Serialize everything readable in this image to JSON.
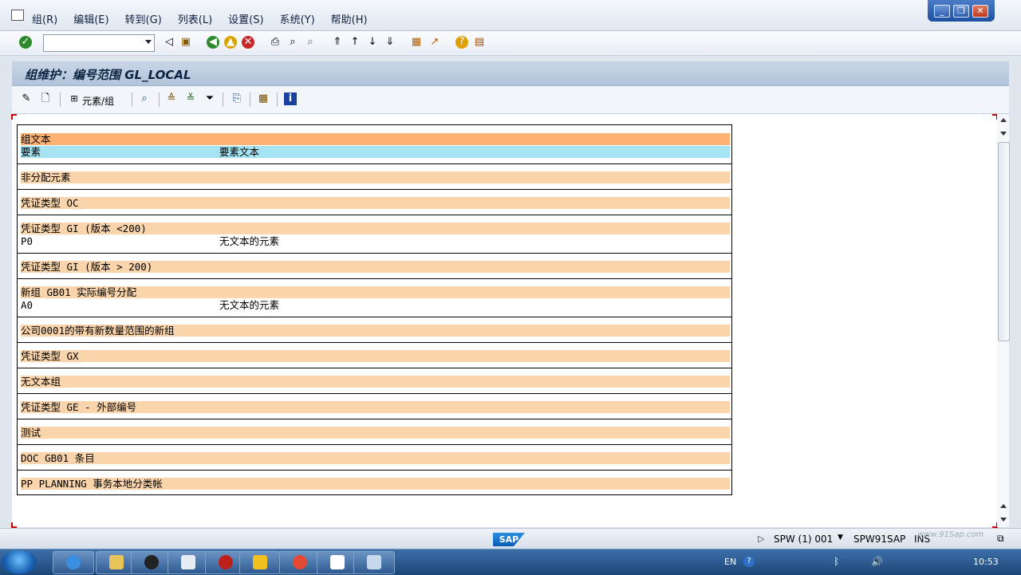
{
  "menu": {
    "items": [
      "组(R)",
      "编辑(E)",
      "转到(G)",
      "列表(L)",
      "设置(S)",
      "系统(Y)",
      "帮助(H)"
    ]
  },
  "command_field": {
    "value": ""
  },
  "title": "组维护：编号范围 GL_LOCAL",
  "app_toolbar": {
    "element_group_label": "元素/组"
  },
  "list": {
    "header": {
      "group_text": "组文本",
      "element": "要素",
      "element_text": "要素文本"
    },
    "blocks": [
      {
        "group": "非分配元素",
        "rows": []
      },
      {
        "group": "凭证类型 OC",
        "rows": []
      },
      {
        "group": "凭证类型 GI (版本 <200)",
        "rows": [
          {
            "element": "P0",
            "text": "无文本的元素"
          }
        ]
      },
      {
        "group": "凭证类型 GI (版本 > 200)",
        "rows": []
      },
      {
        "group": "新组 GB01 实际编号分配",
        "rows": [
          {
            "element": "A0",
            "text": "无文本的元素"
          }
        ]
      },
      {
        "group": "公司0001的带有新数量范围的新组",
        "rows": []
      },
      {
        "group": "凭证类型 GX",
        "rows": []
      },
      {
        "group": "无文本组",
        "rows": []
      },
      {
        "group": "凭证类型 GE - 外部编号",
        "rows": []
      },
      {
        "group": "测试",
        "rows": []
      },
      {
        "group": "DOC GB01 条目",
        "rows": []
      },
      {
        "group": "PP PLANNING 事务本地分类帐",
        "rows": []
      }
    ]
  },
  "status": {
    "logo": "SAP",
    "system": "SPW (1) 001",
    "server": "SPW91SAP",
    "mode": "INS"
  },
  "taskbar": {
    "lang": "EN",
    "time": "10:53",
    "watermark": "www.91Sap.com"
  },
  "colors": {
    "group_row": "#fad5ac",
    "header_group": "#fbb074",
    "header_element": "#a5e3f2"
  }
}
